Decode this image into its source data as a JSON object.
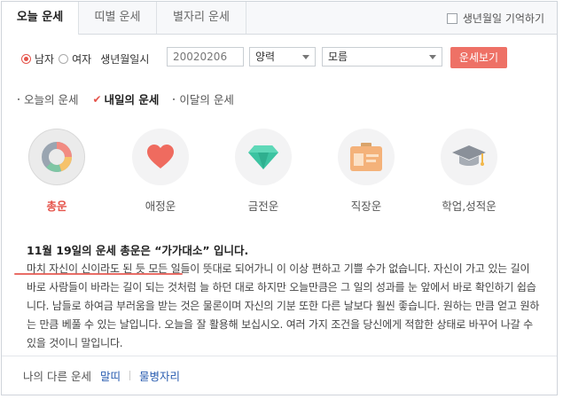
{
  "tabs": [
    {
      "label": "오늘 운세",
      "active": true
    },
    {
      "label": "띠별 운세",
      "active": false
    },
    {
      "label": "별자리 운세",
      "active": false
    }
  ],
  "remember_label": "생년월일 기억하기",
  "form": {
    "gender_male": "남자",
    "gender_female": "여자",
    "selected_gender": "남자",
    "birth_label": "생년월일시",
    "birth_value": "20020206",
    "calendar_value": "양력",
    "time_value": "모름",
    "submit_label": "운세보기"
  },
  "subtabs": [
    {
      "label": "오늘의 운세",
      "active": false
    },
    {
      "label": "내일의 운세",
      "active": true
    },
    {
      "label": "이달의 운세",
      "active": false
    }
  ],
  "categories": [
    {
      "label": "총운",
      "icon": "pie-chart-icon",
      "active": true
    },
    {
      "label": "애정운",
      "icon": "heart-icon",
      "active": false
    },
    {
      "label": "금전운",
      "icon": "diamond-icon",
      "active": false
    },
    {
      "label": "직장운",
      "icon": "id-card-icon",
      "active": false
    },
    {
      "label": "학업,성적운",
      "icon": "graduation-cap-icon",
      "active": false
    }
  ],
  "result": {
    "title": "11월 19일의 운세 총운은 “가가대소” 입니다.",
    "body": "마치 자신이 신이라도 된 듯 모든 일들이 뜻대로 되어가니 이 이상 편하고 기쁠 수가 없습니다. 자신이 가고 있는 길이 바로 사람들이 바라는 길이 되는 것처럼 늘 하던 대로 하지만 오늘만큼은 그 일의 성과를 눈 앞에서 바로 확인하기 쉽습니다. 남들로 하여금 부러움을 받는 것은 물론이며 자신의 기분 또한 다른 날보다 훨씬 좋습니다. 원하는 만큼 얻고 원하는 만큼 베풀 수 있는 날입니다. 오늘을 잘 활용해 보십시오. 여러 가지 조건을 당신에게 적합한 상태로 바꾸어 나갈 수 있을 것이니 말입니다."
  },
  "footer": {
    "label": "나의 다른 운세",
    "link1": "말띠",
    "link2": "물병자리"
  },
  "colors": {
    "accent": "#e5544b",
    "button": "#ee7166",
    "link": "#2a5db0"
  }
}
